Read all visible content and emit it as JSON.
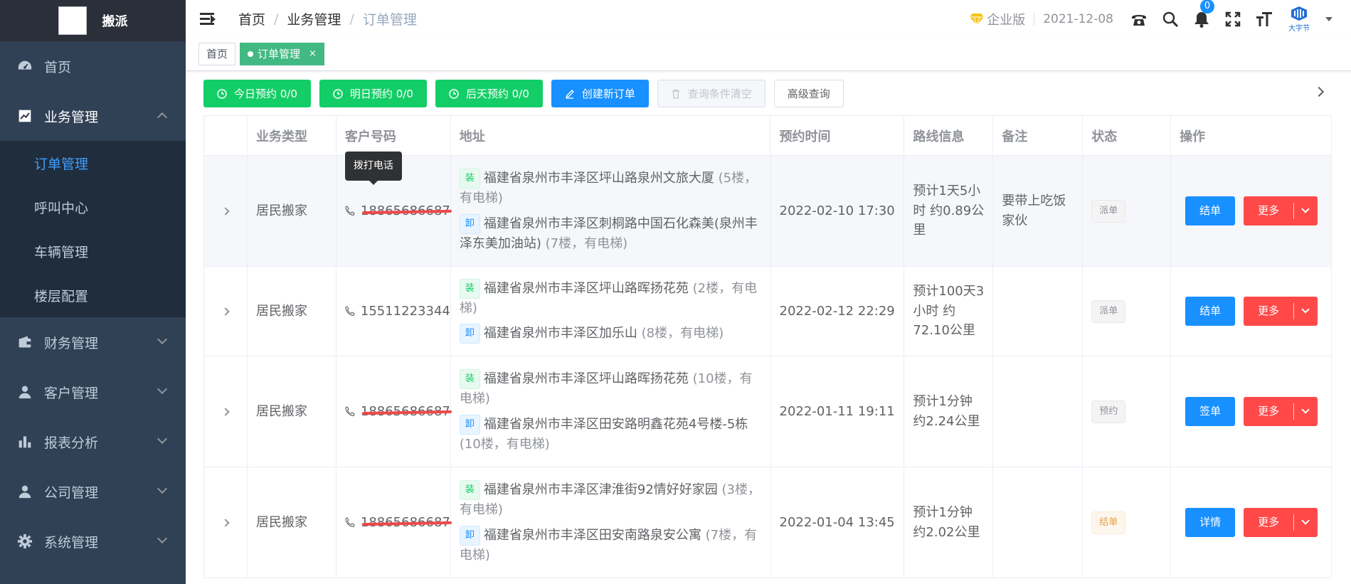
{
  "app": {
    "logo_title": "搬派"
  },
  "sidebar": {
    "items": [
      {
        "label": "首页",
        "icon": "dashboard-icon"
      },
      {
        "label": "业务管理",
        "icon": "chart-icon",
        "expanded": true,
        "children": [
          {
            "label": "订单管理",
            "active": true
          },
          {
            "label": "呼叫中心"
          },
          {
            "label": "车辆管理"
          },
          {
            "label": "楼层配置"
          }
        ]
      },
      {
        "label": "财务管理",
        "icon": "wallet-icon"
      },
      {
        "label": "客户管理",
        "icon": "user-icon"
      },
      {
        "label": "报表分析",
        "icon": "bar-chart-icon"
      },
      {
        "label": "公司管理",
        "icon": "user-icon"
      },
      {
        "label": "系统管理",
        "icon": "gear-icon"
      }
    ]
  },
  "header": {
    "breadcrumb": [
      "首页",
      "业务管理",
      "订单管理"
    ],
    "edition": "企业版",
    "date": "2021-12-08",
    "notification_count": "0",
    "brand_name": "大字节"
  },
  "tags": {
    "home": "首页",
    "active": "订单管理",
    "close": "×"
  },
  "toolbar": {
    "today": "今日预约 0/0",
    "tomorrow": "明日预约 0/0",
    "after_tomorrow": "后天预约 0/0",
    "create": "创建新订单",
    "clear": "查询条件清空",
    "advanced": "高级查询"
  },
  "table": {
    "headers": [
      "",
      "业务类型",
      "客户号码",
      "地址",
      "预约时间",
      "路线信息",
      "备注",
      "状态",
      "操作"
    ],
    "tooltip": "拨打电话",
    "rows": [
      {
        "type": "居民搬家",
        "phone": "18865686687",
        "phone_redacted": true,
        "load_tag": "装",
        "load_addr": "福建省泉州市丰泽区坪山路泉州文旅大厦",
        "load_floor": "(5楼，有电梯)",
        "unload_tag": "卸",
        "unload_addr": "福建省泉州市丰泽区刺桐路中国石化森美(泉州丰泽东美加油站)",
        "unload_floor": "(7楼，有电梯)",
        "time": "2022-02-10 17:30",
        "route": "预计1天5小时 约0.89公里",
        "note": "要带上吃饭家伙",
        "status": "派单",
        "status_style": "info",
        "action": "结单",
        "more": "更多"
      },
      {
        "type": "居民搬家",
        "phone": "15511223344",
        "phone_redacted": false,
        "load_tag": "装",
        "load_addr": "福建省泉州市丰泽区坪山路晖扬花苑",
        "load_floor": "(2楼，有电梯)",
        "unload_tag": "卸",
        "unload_addr": "福建省泉州市丰泽区加乐山",
        "unload_floor": "(8楼，有电梯)",
        "time": "2022-02-12 22:29",
        "route": "预计100天3小时 约72.10公里",
        "note": "",
        "status": "派单",
        "status_style": "info",
        "action": "结单",
        "more": "更多"
      },
      {
        "type": "居民搬家",
        "phone": "18865686687",
        "phone_redacted": true,
        "load_tag": "装",
        "load_addr": "福建省泉州市丰泽区坪山路晖扬花苑",
        "load_floor": "(10楼，有电梯)",
        "unload_tag": "卸",
        "unload_addr": "福建省泉州市丰泽区田安路明鑫花苑4号楼-5栋",
        "unload_floor": "(10楼，有电梯)",
        "time": "2022-01-11 19:11",
        "route": "预计1分钟 约2.24公里",
        "note": "",
        "status": "预约",
        "status_style": "info",
        "action": "签单",
        "more": "更多"
      },
      {
        "type": "居民搬家",
        "phone": "18865686687",
        "phone_redacted": true,
        "load_tag": "装",
        "load_addr": "福建省泉州市丰泽区津淮街92情好好家园",
        "load_floor": "(3楼，有电梯)",
        "unload_tag": "卸",
        "unload_addr": "福建省泉州市丰泽区田安南路泉安公寓",
        "unload_floor": "(7楼，有电梯)",
        "time": "2022-01-04 13:45",
        "route": "预计1分钟 约2.02公里",
        "note": "",
        "status": "结单",
        "status_style": "warning",
        "action": "详情",
        "more": "更多"
      }
    ]
  }
}
